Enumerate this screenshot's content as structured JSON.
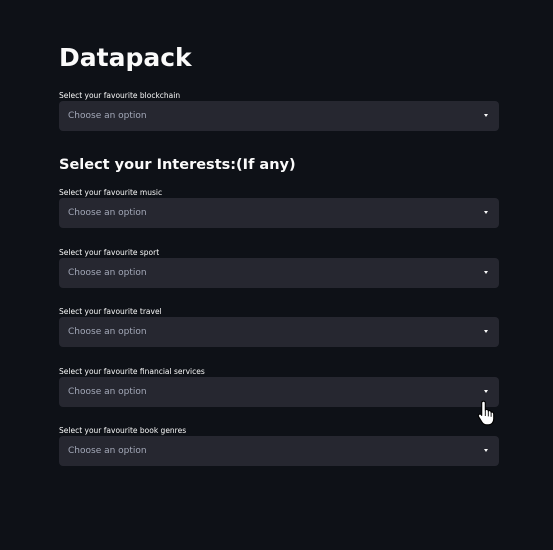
{
  "page": {
    "title": "Datapack"
  },
  "blockchain": {
    "label": "Select your favourite blockchain",
    "value": "Choose an option"
  },
  "interests": {
    "heading": "Select your Interests:(If any)",
    "fields": [
      {
        "label": "Select your favourite music",
        "value": "Choose an option"
      },
      {
        "label": "Select your favourite sport",
        "value": "Choose an option"
      },
      {
        "label": "Select your favourite travel",
        "value": "Choose an option"
      },
      {
        "label": "Select your favourite financial services",
        "value": "Choose an option"
      },
      {
        "label": "Select your favourite book genres",
        "value": "Choose an option"
      }
    ]
  },
  "icons": {
    "dropdown": "chevron-down-icon",
    "cursor": "hand-pointer-icon"
  }
}
